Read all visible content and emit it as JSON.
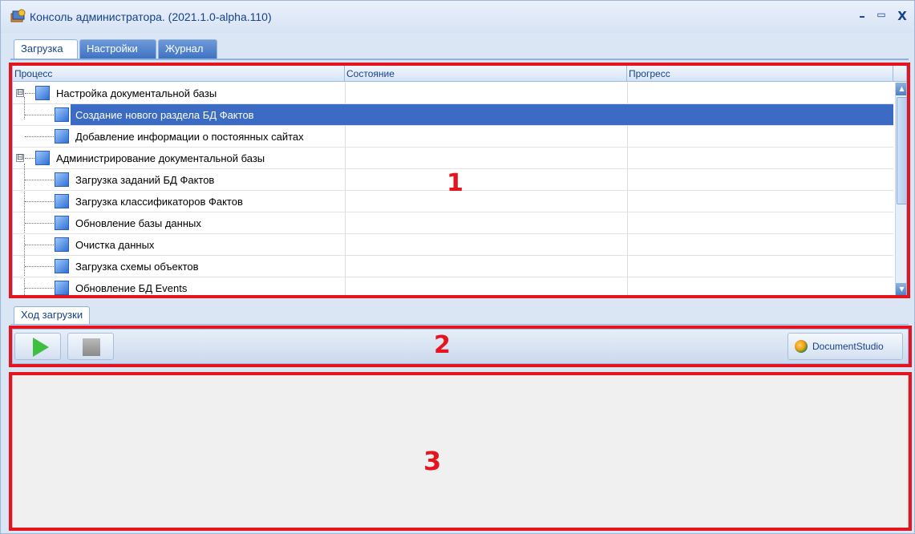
{
  "window": {
    "title": "Консоль администратора. (2021.1.0-alpha.110)",
    "controls": {
      "minimize": "–",
      "maximize": "▭",
      "close": "X"
    }
  },
  "tabs": [
    {
      "label": "Загрузка",
      "active": true
    },
    {
      "label": "Настройки",
      "active": false
    },
    {
      "label": "Журнал",
      "active": false
    }
  ],
  "grid": {
    "columns": [
      "Процесс",
      "Состояние",
      "Прогресс"
    ],
    "rows": [
      {
        "label": "Настройка документальной базы",
        "level": 0,
        "expander": "⊟",
        "selected": false
      },
      {
        "label": "Создание нового раздела БД Фактов",
        "level": 1,
        "selected": true
      },
      {
        "label": "Добавление информации о постоянных сайтах",
        "level": 1,
        "selected": false
      },
      {
        "label": "Администрирование документальной базы",
        "level": 0,
        "expander": "⊟",
        "selected": false
      },
      {
        "label": "Загрузка заданий БД Фактов",
        "level": 1,
        "selected": false
      },
      {
        "label": "Загрузка классификаторов Фактов",
        "level": 1,
        "selected": false
      },
      {
        "label": "Обновление базы данных",
        "level": 1,
        "selected": false
      },
      {
        "label": "Очистка данных",
        "level": 1,
        "selected": false
      },
      {
        "label": "Загрузка схемы объектов",
        "level": 1,
        "selected": false
      },
      {
        "label": "Обновление БД Events",
        "level": 1,
        "selected": false
      }
    ]
  },
  "progress_tab": {
    "label": "Ход загрузки"
  },
  "toolbar": {
    "start_icon": "play-icon",
    "stop_icon": "stop-icon",
    "documentstudio_label": "DocumentStudio"
  },
  "annotations": {
    "box1": "1",
    "box2": "2",
    "box3": "3",
    "color": "#e4151e"
  }
}
